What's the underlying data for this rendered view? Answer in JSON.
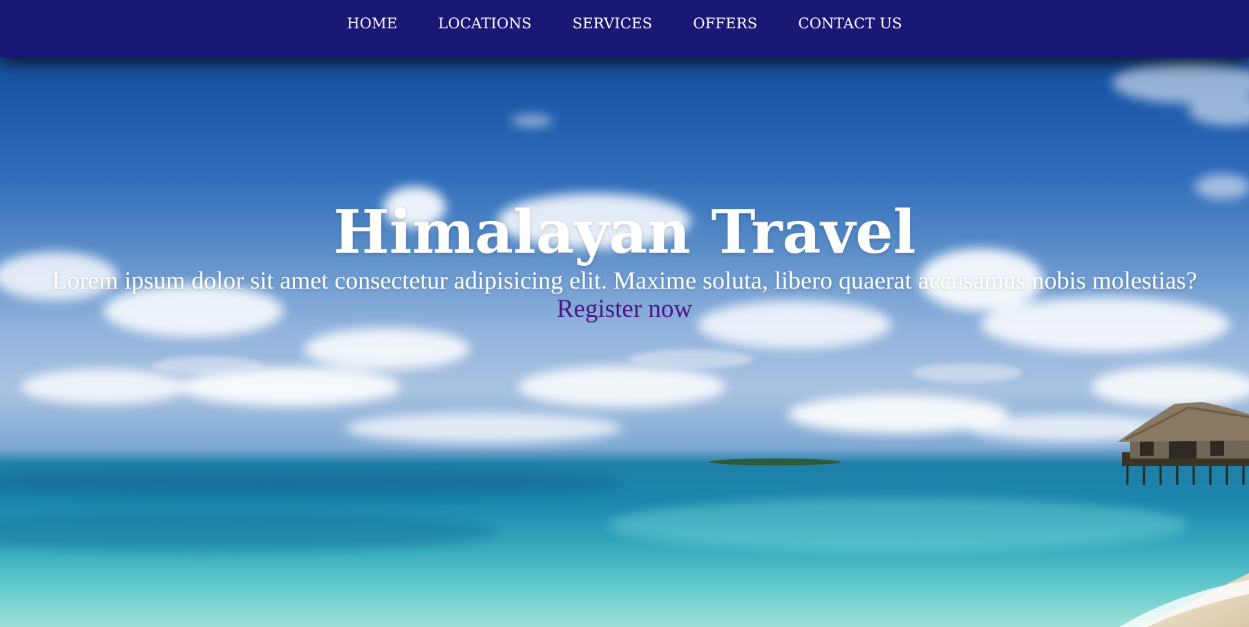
{
  "nav": {
    "items": [
      {
        "label": "HOME"
      },
      {
        "label": "LOCATIONS"
      },
      {
        "label": "SERVICES"
      },
      {
        "label": "OFFERS"
      },
      {
        "label": "CONTACT US"
      }
    ]
  },
  "hero": {
    "title": "Himalayan Travel",
    "subtitle": "Lorem ipsum dolor sit amet consectetur adipisicing elit. Maxime soluta, libero quaerat accusamus nobis molestias?",
    "cta_label": "Register now"
  },
  "colors": {
    "nav_background": "#1b1775",
    "nav_text": "#ffffff",
    "title_text": "#ffffff",
    "cta_link": "#4b1585"
  }
}
